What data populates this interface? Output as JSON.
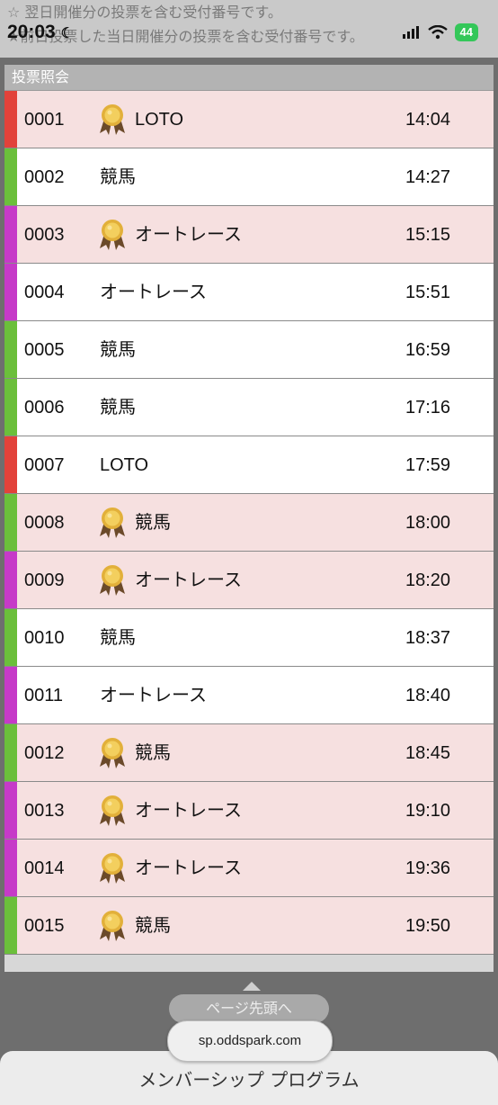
{
  "notice": {
    "line1": "☆ 翌日開催分の投票を含む受付番号です。",
    "line2": "★前日投票した当日開催分の投票を含む受付番号です。"
  },
  "status_bar": {
    "time": "20:03",
    "battery": "44"
  },
  "panel": {
    "title": "投票照会"
  },
  "colors": {
    "loto": "#e2423a",
    "keiba": "#6bbf3b",
    "autorace": "#c63ac8"
  },
  "rows": [
    {
      "number": "0001",
      "type": "LOTO",
      "time": "14:04",
      "medal": true
    },
    {
      "number": "0002",
      "type": "競馬",
      "time": "14:27",
      "medal": false
    },
    {
      "number": "0003",
      "type": "オートレース",
      "time": "15:15",
      "medal": true
    },
    {
      "number": "0004",
      "type": "オートレース",
      "time": "15:51",
      "medal": false
    },
    {
      "number": "0005",
      "type": "競馬",
      "time": "16:59",
      "medal": false
    },
    {
      "number": "0006",
      "type": "競馬",
      "time": "17:16",
      "medal": false
    },
    {
      "number": "0007",
      "type": "LOTO",
      "time": "17:59",
      "medal": false
    },
    {
      "number": "0008",
      "type": "競馬",
      "time": "18:00",
      "medal": true
    },
    {
      "number": "0009",
      "type": "オートレース",
      "time": "18:20",
      "medal": true
    },
    {
      "number": "0010",
      "type": "競馬",
      "time": "18:37",
      "medal": false
    },
    {
      "number": "0011",
      "type": "オートレース",
      "time": "18:40",
      "medal": false
    },
    {
      "number": "0012",
      "type": "競馬",
      "time": "18:45",
      "medal": true
    },
    {
      "number": "0013",
      "type": "オートレース",
      "time": "19:10",
      "medal": true
    },
    {
      "number": "0014",
      "type": "オートレース",
      "time": "19:36",
      "medal": true
    },
    {
      "number": "0015",
      "type": "競馬",
      "time": "19:50",
      "medal": true
    }
  ],
  "footer": {
    "top_button": "ページ先頭へ",
    "url": "sp.oddspark.com",
    "card_title": "メンバーシップ プログラム"
  }
}
